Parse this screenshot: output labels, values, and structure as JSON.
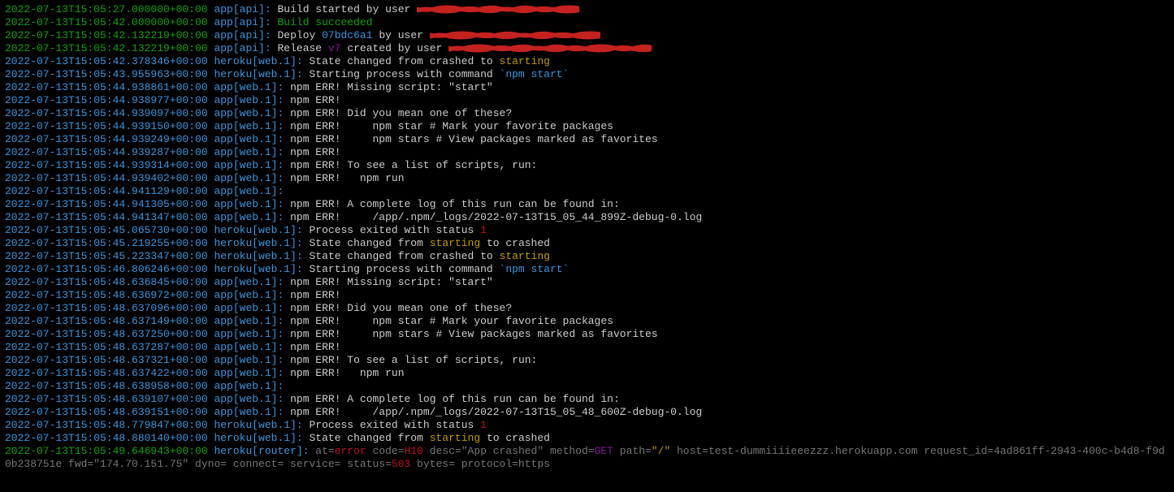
{
  "colors": {
    "ts_green": "#13a10e",
    "ts_teal": "#3a96dd",
    "msg": "#cccccc",
    "yellow": "#c19c00",
    "red": "#c50f1f",
    "purple": "#881798",
    "grey": "#767676",
    "bg": "#000000",
    "redact": "#c5221f"
  },
  "lines": [
    {
      "ts": "2022-07-13T15:05:27.000000+00:00",
      "src": "app[api]:",
      "ts_cls": "ts-green",
      "msg": [
        {
          "t": "Build started by user ",
          "c": "msg"
        }
      ],
      "redact": 200
    },
    {
      "ts": "2022-07-13T15:05:42.000000+00:00",
      "src": "app[api]:",
      "ts_cls": "ts-green",
      "msg": [
        {
          "t": "Build succeeded",
          "c": "msg-green"
        }
      ]
    },
    {
      "ts": "2022-07-13T15:05:42.132219+00:00",
      "src": "app[api]:",
      "ts_cls": "ts-green",
      "msg": [
        {
          "t": "Deploy ",
          "c": "msg"
        },
        {
          "t": "07bdc6a1",
          "c": "accent-cyan"
        },
        {
          "t": " by user ",
          "c": "msg"
        }
      ],
      "redact": 210
    },
    {
      "ts": "2022-07-13T15:05:42.132219+00:00",
      "src": "app[api]:",
      "ts_cls": "ts-green",
      "msg": [
        {
          "t": "Release ",
          "c": "msg"
        },
        {
          "t": "v7",
          "c": "accent-purple"
        },
        {
          "t": " created by user ",
          "c": "msg"
        }
      ],
      "redact": 250
    },
    {
      "ts": "2022-07-13T15:05:42.378346+00:00",
      "src": "heroku[web.1]:",
      "ts_cls": "ts-teal",
      "msg": [
        {
          "t": "State changed from crashed to ",
          "c": "msg"
        },
        {
          "t": "starting",
          "c": "accent-yellow"
        }
      ]
    },
    {
      "ts": "2022-07-13T15:05:43.955963+00:00",
      "src": "heroku[web.1]:",
      "ts_cls": "ts-teal",
      "msg": [
        {
          "t": "Starting process with command ",
          "c": "msg"
        },
        {
          "t": "`npm start`",
          "c": "accent-cyan"
        }
      ]
    },
    {
      "ts": "2022-07-13T15:05:44.938861+00:00",
      "src": "app[web.1]:",
      "ts_cls": "ts-teal",
      "msg": [
        {
          "t": "npm ERR! Missing script: \"start\"",
          "c": "msg"
        }
      ]
    },
    {
      "ts": "2022-07-13T15:05:44.938977+00:00",
      "src": "app[web.1]:",
      "ts_cls": "ts-teal",
      "msg": [
        {
          "t": "npm ERR!",
          "c": "msg"
        }
      ]
    },
    {
      "ts": "2022-07-13T15:05:44.939097+00:00",
      "src": "app[web.1]:",
      "ts_cls": "ts-teal",
      "msg": [
        {
          "t": "npm ERR! Did you mean one of these?",
          "c": "msg"
        }
      ]
    },
    {
      "ts": "2022-07-13T15:05:44.939150+00:00",
      "src": "app[web.1]:",
      "ts_cls": "ts-teal",
      "msg": [
        {
          "t": "npm ERR!     npm star # Mark your favorite packages",
          "c": "msg"
        }
      ]
    },
    {
      "ts": "2022-07-13T15:05:44.939249+00:00",
      "src": "app[web.1]:",
      "ts_cls": "ts-teal",
      "msg": [
        {
          "t": "npm ERR!     npm stars # View packages marked as favorites",
          "c": "msg"
        }
      ]
    },
    {
      "ts": "2022-07-13T15:05:44.939287+00:00",
      "src": "app[web.1]:",
      "ts_cls": "ts-teal",
      "msg": [
        {
          "t": "npm ERR!",
          "c": "msg"
        }
      ]
    },
    {
      "ts": "2022-07-13T15:05:44.939314+00:00",
      "src": "app[web.1]:",
      "ts_cls": "ts-teal",
      "msg": [
        {
          "t": "npm ERR! To see a list of scripts, run:",
          "c": "msg"
        }
      ]
    },
    {
      "ts": "2022-07-13T15:05:44.939402+00:00",
      "src": "app[web.1]:",
      "ts_cls": "ts-teal",
      "msg": [
        {
          "t": "npm ERR!   npm run",
          "c": "msg"
        }
      ]
    },
    {
      "ts": "2022-07-13T15:05:44.941129+00:00",
      "src": "app[web.1]:",
      "ts_cls": "ts-teal",
      "msg": []
    },
    {
      "ts": "2022-07-13T15:05:44.941305+00:00",
      "src": "app[web.1]:",
      "ts_cls": "ts-teal",
      "msg": [
        {
          "t": "npm ERR! A complete log of this run can be found in:",
          "c": "msg"
        }
      ]
    },
    {
      "ts": "2022-07-13T15:05:44.941347+00:00",
      "src": "app[web.1]:",
      "ts_cls": "ts-teal",
      "msg": [
        {
          "t": "npm ERR!     /app/.npm/_logs/2022-07-13T15_05_44_899Z-debug-0.log",
          "c": "msg"
        }
      ]
    },
    {
      "ts": "2022-07-13T15:05:45.065730+00:00",
      "src": "heroku[web.1]:",
      "ts_cls": "ts-teal",
      "msg": [
        {
          "t": "Process exited with status ",
          "c": "msg"
        },
        {
          "t": "1",
          "c": "accent-red"
        }
      ]
    },
    {
      "ts": "2022-07-13T15:05:45.219255+00:00",
      "src": "heroku[web.1]:",
      "ts_cls": "ts-teal",
      "msg": [
        {
          "t": "State changed from ",
          "c": "msg"
        },
        {
          "t": "starting",
          "c": "accent-yellow"
        },
        {
          "t": " to crashed",
          "c": "msg"
        }
      ]
    },
    {
      "ts": "2022-07-13T15:05:45.223347+00:00",
      "src": "heroku[web.1]:",
      "ts_cls": "ts-teal",
      "msg": [
        {
          "t": "State changed from crashed to ",
          "c": "msg"
        },
        {
          "t": "starting",
          "c": "accent-yellow"
        }
      ]
    },
    {
      "ts": "2022-07-13T15:05:46.806246+00:00",
      "src": "heroku[web.1]:",
      "ts_cls": "ts-teal",
      "msg": [
        {
          "t": "Starting process with command ",
          "c": "msg"
        },
        {
          "t": "`npm start`",
          "c": "accent-cyan"
        }
      ]
    },
    {
      "ts": "2022-07-13T15:05:48.636845+00:00",
      "src": "app[web.1]:",
      "ts_cls": "ts-teal",
      "msg": [
        {
          "t": "npm ERR! Missing script: \"start\"",
          "c": "msg"
        }
      ]
    },
    {
      "ts": "2022-07-13T15:05:48.636972+00:00",
      "src": "app[web.1]:",
      "ts_cls": "ts-teal",
      "msg": [
        {
          "t": "npm ERR!",
          "c": "msg"
        }
      ]
    },
    {
      "ts": "2022-07-13T15:05:48.637096+00:00",
      "src": "app[web.1]:",
      "ts_cls": "ts-teal",
      "msg": [
        {
          "t": "npm ERR! Did you mean one of these?",
          "c": "msg"
        }
      ]
    },
    {
      "ts": "2022-07-13T15:05:48.637149+00:00",
      "src": "app[web.1]:",
      "ts_cls": "ts-teal",
      "msg": [
        {
          "t": "npm ERR!     npm star # Mark your favorite packages",
          "c": "msg"
        }
      ]
    },
    {
      "ts": "2022-07-13T15:05:48.637250+00:00",
      "src": "app[web.1]:",
      "ts_cls": "ts-teal",
      "msg": [
        {
          "t": "npm ERR!     npm stars # View packages marked as favorites",
          "c": "msg"
        }
      ]
    },
    {
      "ts": "2022-07-13T15:05:48.637287+00:00",
      "src": "app[web.1]:",
      "ts_cls": "ts-teal",
      "msg": [
        {
          "t": "npm ERR!",
          "c": "msg"
        }
      ]
    },
    {
      "ts": "2022-07-13T15:05:48.637321+00:00",
      "src": "app[web.1]:",
      "ts_cls": "ts-teal",
      "msg": [
        {
          "t": "npm ERR! To see a list of scripts, run:",
          "c": "msg"
        }
      ]
    },
    {
      "ts": "2022-07-13T15:05:48.637422+00:00",
      "src": "app[web.1]:",
      "ts_cls": "ts-teal",
      "msg": [
        {
          "t": "npm ERR!   npm run",
          "c": "msg"
        }
      ]
    },
    {
      "ts": "2022-07-13T15:05:48.638958+00:00",
      "src": "app[web.1]:",
      "ts_cls": "ts-teal",
      "msg": []
    },
    {
      "ts": "2022-07-13T15:05:48.639107+00:00",
      "src": "app[web.1]:",
      "ts_cls": "ts-teal",
      "msg": [
        {
          "t": "npm ERR! A complete log of this run can be found in:",
          "c": "msg"
        }
      ]
    },
    {
      "ts": "2022-07-13T15:05:48.639151+00:00",
      "src": "app[web.1]:",
      "ts_cls": "ts-teal",
      "msg": [
        {
          "t": "npm ERR!     /app/.npm/_logs/2022-07-13T15_05_48_600Z-debug-0.log",
          "c": "msg"
        }
      ]
    },
    {
      "ts": "2022-07-13T15:05:48.779847+00:00",
      "src": "heroku[web.1]:",
      "ts_cls": "ts-teal",
      "msg": [
        {
          "t": "Process exited with status ",
          "c": "msg"
        },
        {
          "t": "1",
          "c": "accent-red"
        }
      ]
    },
    {
      "ts": "2022-07-13T15:05:48.880140+00:00",
      "src": "heroku[web.1]:",
      "ts_cls": "ts-teal",
      "msg": [
        {
          "t": "State changed from ",
          "c": "msg"
        },
        {
          "t": "starting",
          "c": "accent-yellow"
        },
        {
          "t": " to crashed",
          "c": "msg"
        }
      ]
    }
  ],
  "router_line": {
    "ts": "2022-07-13T15:05:49.646943+00:00",
    "src": "heroku[router]:",
    "segments": [
      {
        "t": " at=",
        "c": "dim-grey"
      },
      {
        "t": "error",
        "c": "accent-red"
      },
      {
        "t": " code=",
        "c": "dim-grey"
      },
      {
        "t": "H10",
        "c": "accent-red"
      },
      {
        "t": " desc=\"App crashed\" method=",
        "c": "dim-grey"
      },
      {
        "t": "GET",
        "c": "accent-purple"
      },
      {
        "t": " path=",
        "c": "dim-grey"
      },
      {
        "t": "\"/\"",
        "c": "accent-yellow"
      },
      {
        "t": " host=test-dummiiiieeezzz.herokuapp.com request_id=4ad861ff-2943-400c-b4d8-f9d0b238751e fwd=\"174.70.151.75\" dyno= connect= service= status=",
        "c": "dim-grey"
      },
      {
        "t": "503",
        "c": "accent-red"
      },
      {
        "t": " bytes= protocol=https",
        "c": "dim-grey"
      }
    ]
  }
}
